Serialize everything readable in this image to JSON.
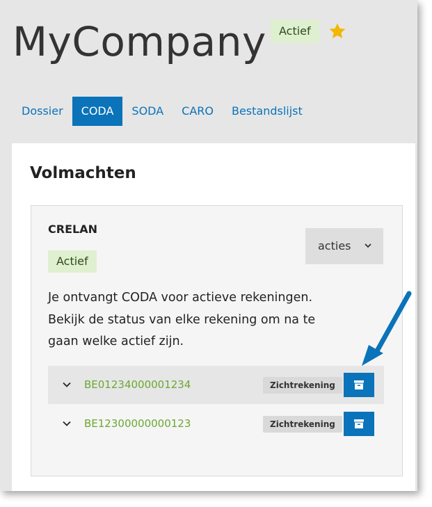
{
  "header": {
    "company_name": "MyCompany",
    "status_badge": "Actief",
    "favorite_icon": "star-icon"
  },
  "tabs": [
    {
      "label": "Dossier",
      "active": false
    },
    {
      "label": "CODA",
      "active": true
    },
    {
      "label": "SODA",
      "active": false
    },
    {
      "label": "CARO",
      "active": false
    },
    {
      "label": "Bestandslijst",
      "active": false
    }
  ],
  "section": {
    "title": "Volmachten"
  },
  "mandate": {
    "bank": "CRELAN",
    "status_badge": "Actief",
    "actions_label": "acties",
    "description": "Je ontvangt CODA voor actieve rekeningen. Bekijk de status van elke rekening om na te gaan welke actief zijn.",
    "accounts": [
      {
        "number": "BE01234000001234",
        "type": "Zichtrekening",
        "action_icon": "archive-icon"
      },
      {
        "number": "BE12300000000123",
        "type": "Zichtrekening",
        "action_icon": "archive-icon"
      }
    ]
  },
  "colors": {
    "primary": "#0a73b9",
    "active_badge_bg": "#dff0d0",
    "account_number": "#6aa832",
    "star": "#f2b705"
  }
}
